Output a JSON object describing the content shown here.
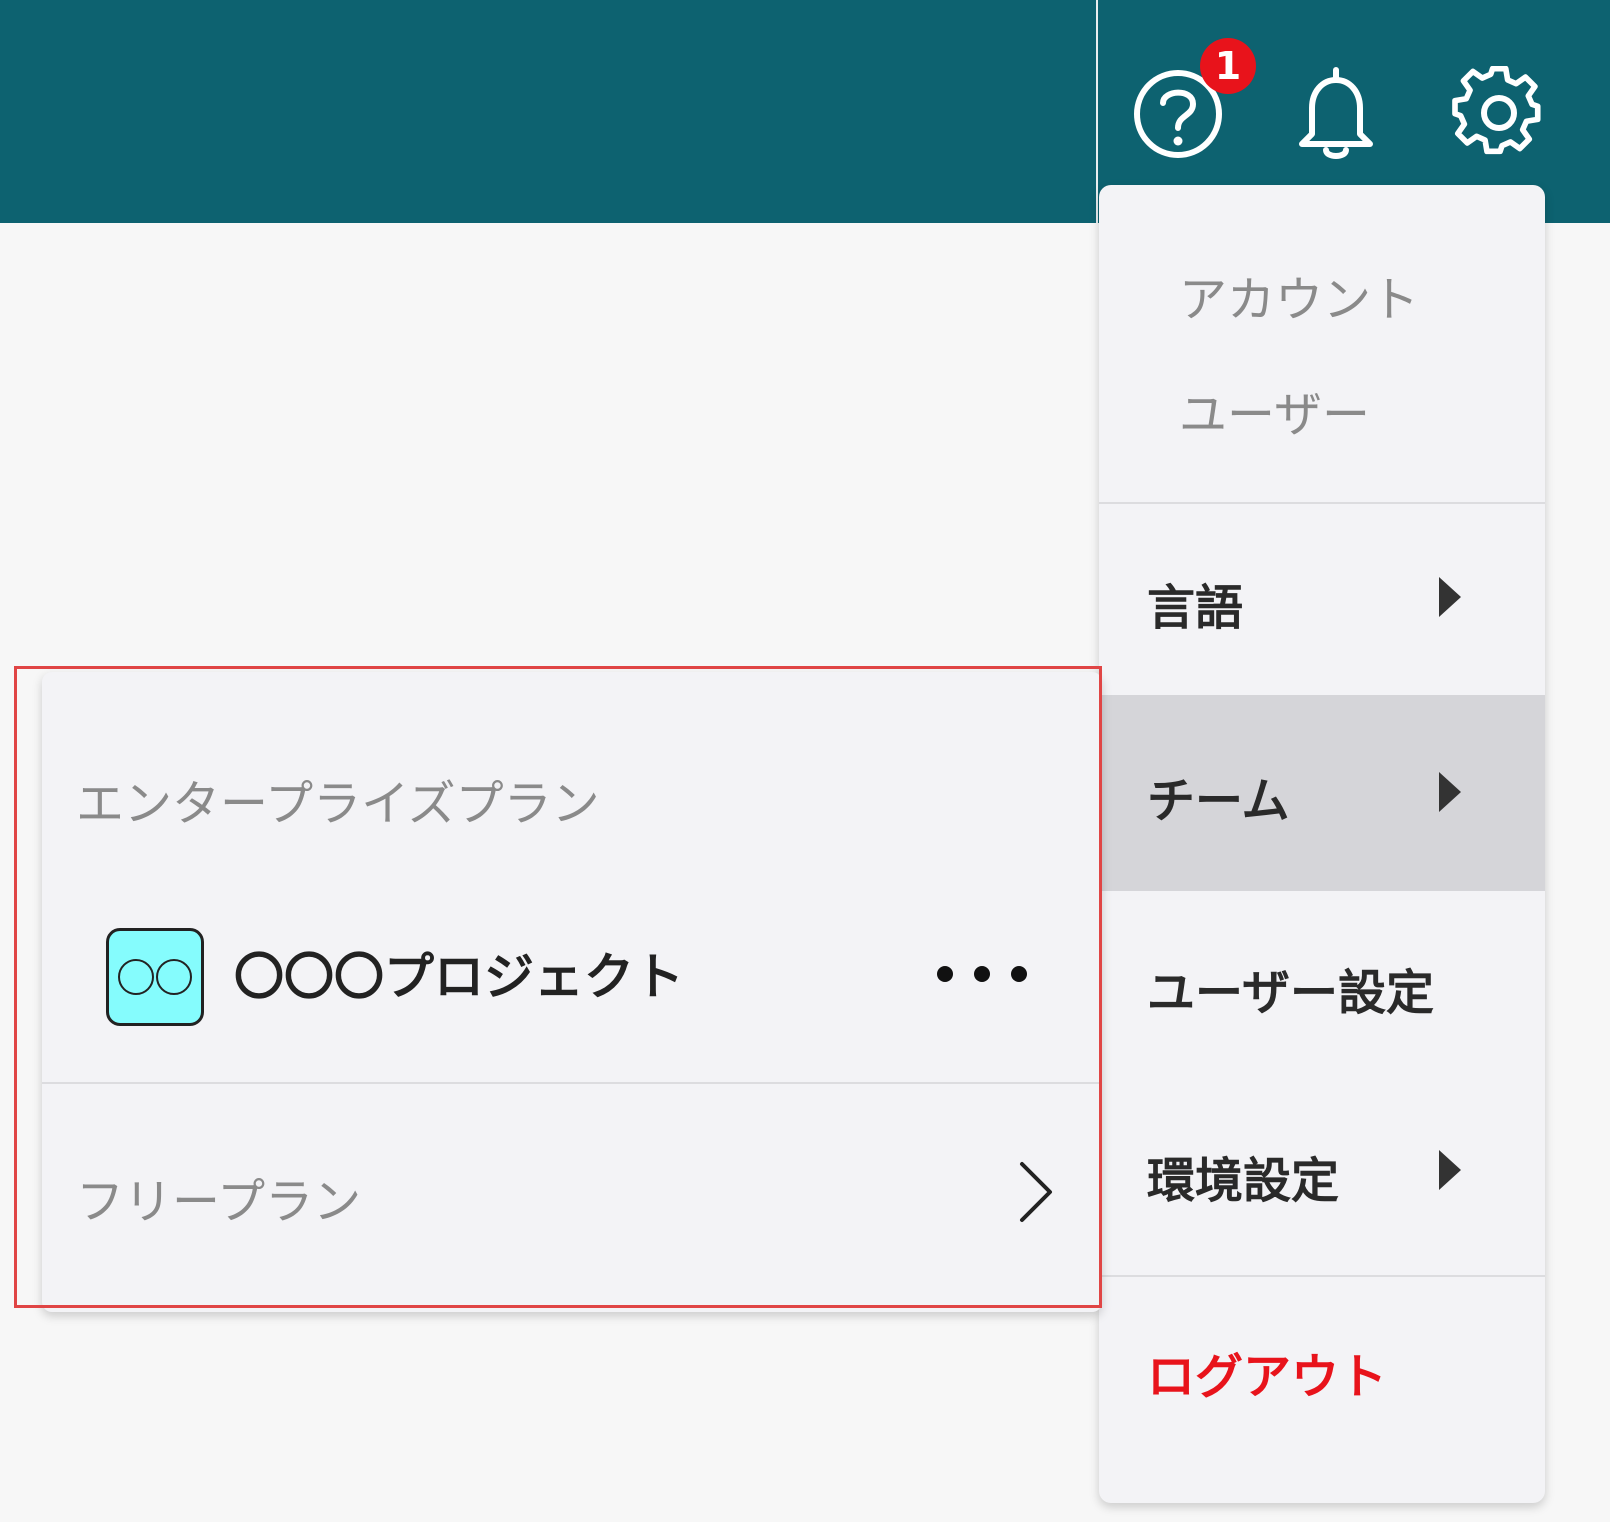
{
  "header": {
    "help_badge": "1",
    "icons": [
      "help-icon",
      "bell-icon",
      "gear-icon"
    ],
    "background_color": "#0d6270"
  },
  "settings_menu": {
    "account_label": "アカウント",
    "users_label": "ユーザー",
    "language_label": "言語",
    "team_label": "チーム",
    "user_settings_label": "ユーザー設定",
    "environment_label": "環境設定",
    "logout_label": "ログアウト",
    "active_item": "team",
    "logout_color": "#e8131b"
  },
  "team_submenu": {
    "enterprise_label": "エンタープライズプラン",
    "project_name": "〇〇〇プロジェクト",
    "avatar_color": "#85fcfd",
    "free_label": "フリープラン"
  }
}
